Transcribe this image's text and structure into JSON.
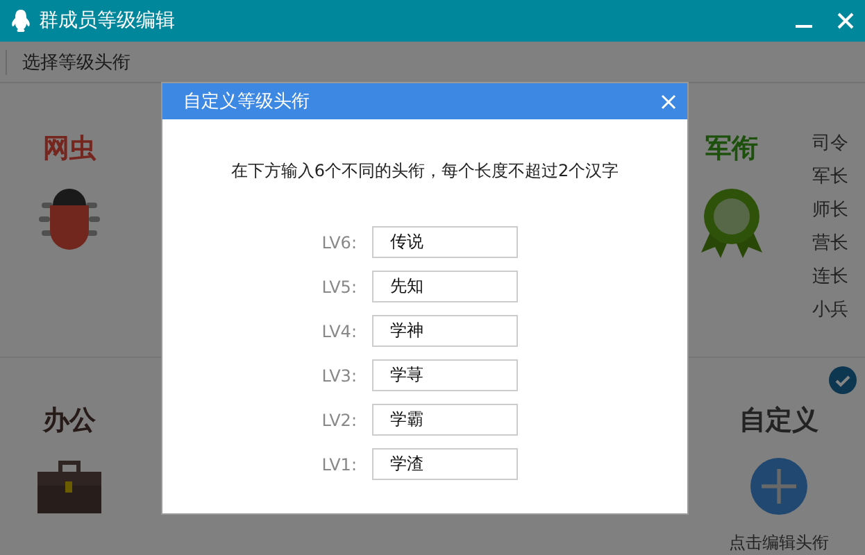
{
  "window": {
    "title": "群成员等级编辑"
  },
  "toolbar": {
    "label": "选择等级头衔"
  },
  "categories": [
    {
      "name": "网虫",
      "kind": "bug",
      "selected": false
    },
    {
      "name": "军衔",
      "kind": "medal",
      "selected": false,
      "titles": [
        "司令",
        "军长",
        "师长",
        "营长",
        "连长",
        "小兵"
      ]
    },
    {
      "name": "办公",
      "kind": "briefcase",
      "selected": false
    },
    {
      "name": "自定义",
      "kind": "custom",
      "selected": true,
      "caption": "点击编辑头衔"
    }
  ],
  "dialog": {
    "title": "自定义等级头衔",
    "instruction": "在下方输入6个不同的头衔，每个长度不超过2个汉字",
    "fields": [
      {
        "label": "LV6:",
        "value": "传说"
      },
      {
        "label": "LV5:",
        "value": "先知"
      },
      {
        "label": "LV4:",
        "value": "学神"
      },
      {
        "label": "LV3:",
        "value": "学荨"
      },
      {
        "label": "LV2:",
        "value": "学霸"
      },
      {
        "label": "LV1:",
        "value": "学渣"
      }
    ]
  }
}
